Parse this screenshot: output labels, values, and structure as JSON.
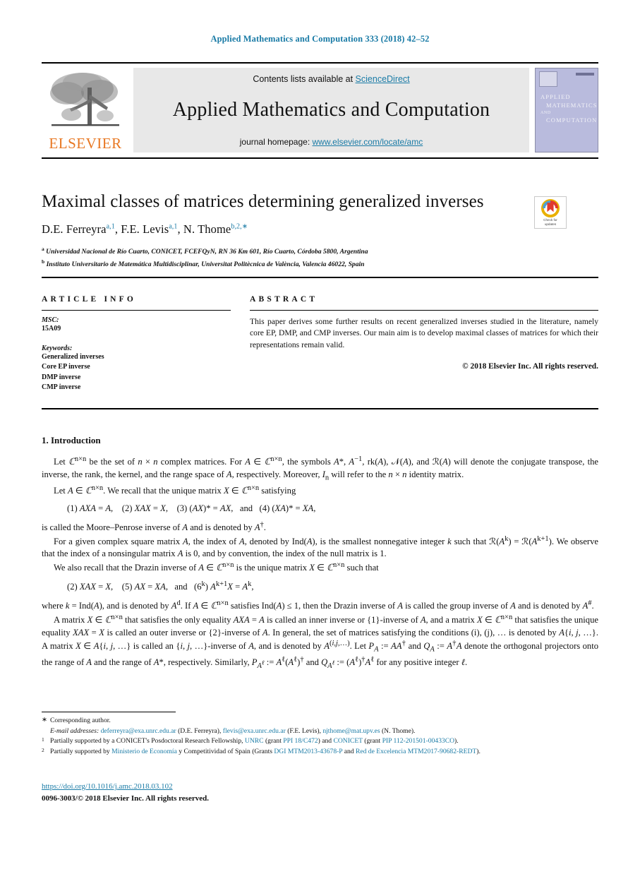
{
  "running_head": "Applied Mathematics and Computation 333 (2018) 42–52",
  "masthead": {
    "contents_prefix": "Contents lists available at ",
    "sciencedirect": "ScienceDirect",
    "journal_name": "Applied Mathematics and Computation",
    "homepage_prefix": "journal homepage: ",
    "homepage_url": "www.elsevier.com/locate/amc",
    "publisher": "ELSEVIER",
    "cover": {
      "line1": "APPLIED",
      "line2": "MATHEMATICS",
      "line3": "AND",
      "line4": "COMPUTATION"
    }
  },
  "article": {
    "title": "Maximal classes of matrices determining generalized inverses",
    "authors_html": "D.E. Ferreyra<sup>a,1</sup>, F.E. Levis<sup>a,1</sup>, N. Thome<sup>b,2,</sup><sup class=\"star\">∗</sup>",
    "affiliation_a": "Universidad Nacional de Río Cuarto, CONICET, FCEFQyN, RN 36 Km 601, Río Cuarto, Córdoba 5800, Argentina",
    "affiliation_b": "Instituto Universitario de Matemática Multidisciplinar, Universitat Politècnica de València, Valencia 46022, Spain",
    "crossmark_line1": "Check for",
    "crossmark_line2": "updates"
  },
  "info": {
    "heading": "ARTICLE INFO",
    "msc_label": "MSC:",
    "msc_value": "15A09",
    "keywords_label": "Keywords:",
    "keywords": [
      "Generalized inverses",
      "Core EP inverse",
      "DMP inverse",
      "CMP inverse"
    ]
  },
  "abstract": {
    "heading": "ABSTRACT",
    "text": "This paper derives some further results on recent generalized inverses studied in the literature, namely core EP, DMP, and CMP inverses. Our main aim is to develop maximal classes of matrices for which their representations remain valid.",
    "copyright": "© 2018 Elsevier Inc. All rights reserved."
  },
  "body": {
    "section_number_title": "1. Introduction",
    "p1_html": "Let <span class=\"mathit\"><i>ℂ</i><sup>n×n</sup></span> be the set of <i>n</i> × <i>n</i> complex matrices. For <i>A</i> ∈ <i>ℂ</i><sup>n×n</sup>, the symbols <i>A</i>*, <i>A</i><sup>−1</sup>, rk(<i>A</i>), 𝒩(<i>A</i>), and ℛ(<i>A</i>) will denote the conjugate transpose, the inverse, the rank, the kernel, and the range space of <i>A</i>, respectively. Moreover, <i>I</i><sub>n</sub> will refer to the <i>n</i> × <i>n</i> identity matrix.",
    "p2_html": "Let <i>A</i> ∈ <i>ℂ</i><sup>n×n</sup>. We recall that the unique matrix <i>X</i> ∈ <i>ℂ</i><sup>n×n</sup> satisfying",
    "eq1_html": "(1) <i>AXA</i> = <i>A</i>,&nbsp;&nbsp;&nbsp; (2) <i>XAX</i> = <i>X</i>,&nbsp;&nbsp;&nbsp; (3) (<i>AX</i>)* = <i>AX</i>,&nbsp;&nbsp; and&nbsp;&nbsp; (4) (<i>XA</i>)* = <i>XA</i>,",
    "p3_html": "is called the Moore–Penrose inverse of <i>A</i> and is denoted by <i>A</i><sup>†</sup>.",
    "p4_html": "For a given complex square matrix <i>A</i>, the index of <i>A</i>, denoted by Ind(<i>A</i>), is the smallest nonnegative integer <i>k</i> such that ℛ(<i>A</i><sup>k</sup>) = ℛ(<i>A</i><sup>k+1</sup>). We observe that the index of a nonsingular matrix <i>A</i> is 0, and by convention, the index of the null matrix is 1.",
    "p5_html": "We also recall that the Drazin inverse of <i>A</i> ∈ <i>ℂ</i><sup>n×n</sup> is the unique matrix <i>X</i> ∈ <i>ℂ</i><sup>n×n</sup> such that",
    "eq2_html": "(2) <i>XAX</i> = <i>X</i>,&nbsp;&nbsp;&nbsp; (5) <i>AX</i> = <i>XA</i>,&nbsp;&nbsp; and&nbsp;&nbsp; (6<sup>k</sup>) <i>A</i><sup>k+1</sup><i>X</i> = <i>A</i><sup>k</sup>,",
    "p6_html": "where <i>k</i> = Ind(<i>A</i>), and is denoted by <i>A</i><sup>d</sup>. If <i>A</i> ∈ <i>ℂ</i><sup>n×n</sup> satisfies Ind(<i>A</i>) ≤ 1, then the Drazin inverse of <i>A</i> is called the group inverse of <i>A</i> and is denoted by <i>A</i><sup>#</sup>.",
    "p7_html": "A matrix <i>X</i> ∈ <i>ℂ</i><sup>n×n</sup> that satisfies the only equality <i>AXA</i> = <i>A</i> is called an inner inverse or {1}-inverse of <i>A</i>, and a matrix <i>X</i> ∈ <i>ℂ</i><sup>n×n</sup> that satisfies the unique equality <i>XAX</i> = <i>X</i> is called an outer inverse or {2}-inverse of <i>A</i>. In general, the set of matrices satisfying the conditions (i), (j), … is denoted by <i>A</i>{<i>i</i>, <i>j</i>, …}. A matrix <i>X</i> ∈ <i>A</i>{<i>i</i>, <i>j</i>, …} is called an {<i>i</i>, <i>j</i>, …}-inverse of <i>A</i>, and is denoted by <i>A</i><sup>(<i>i</i>,<i>j</i>,…)</sup>. Let <i>P<sub>A</sub></i> := <i>AA</i><sup>†</sup> and <i>Q<sub>A</sub></i> := <i>A</i><sup>†</sup><i>A</i> denote the orthogonal projectors onto the range of <i>A</i> and the range of <i>A</i>*, respectively. Similarly, <i>P<sub>A<sup>ℓ</sup></sub></i> := <i>A</i><sup>ℓ</sup>(<i>A</i><sup>ℓ</sup>)<sup>†</sup> and <i>Q<sub>A<sup>ℓ</sup></sub></i> := (<i>A</i><sup>ℓ</sup>)<sup>†</sup><i>A</i><sup>ℓ</sup> for any positive integer <i>ℓ</i>."
  },
  "footnotes": {
    "corresponding": "Corresponding author.",
    "corresponding_mark": "∗",
    "emails_html": "<span class=\"em-it\">E-mail addresses:</span> <span class=\"lnk\">deferreyra@exa.unrc.edu.ar</span> (D.E. Ferreyra), <span class=\"lnk\">flevis@exa.unrc.edu.ar</span> (F.E. Levis), <span class=\"lnk\">njthome@mat.upv.es</span> (N. Thome).",
    "fn1_html": "Partially supported by a CONICET's Posdoctoral Research Fellowship, <span class=\"lnk\">UNRC</span> (grant <span class=\"lnk\">PPI 18/C472</span>) and <span class=\"lnk\">CONICET</span> (grant <span class=\"lnk\">PIP 112-201501-00433CO</span>).",
    "fn1_mark": "1",
    "fn2_html": "Partially supported by <span class=\"lnk\">Ministerio de Economía</span> y Competitividad of Spain (Grants <span class=\"lnk\">DGI MTM2013-43678-P</span> and <span class=\"lnk\">Red de Excelencia MTM2017-90682-REDT</span>).",
    "fn2_mark": "2"
  },
  "footer": {
    "doi": "https://doi.org/10.1016/j.amc.2018.03.102",
    "issn_line": "0096-3003/© 2018 Elsevier Inc. All rights reserved."
  },
  "colors": {
    "link": "#1a7ba6",
    "elsevier_orange": "#E87722",
    "band_gray": "#e8e8e8",
    "cover_purple": "#b9bbdd"
  }
}
